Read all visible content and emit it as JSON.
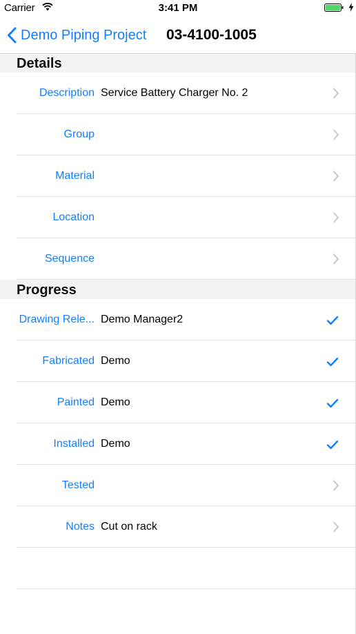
{
  "status_bar": {
    "carrier": "Carrier",
    "time": "3:41 PM"
  },
  "nav": {
    "back_label": "Demo Piping Project",
    "title": "03-4100-1005"
  },
  "sections": {
    "details": {
      "title": "Details",
      "rows": [
        {
          "label": "Description",
          "value": "Service Battery Charger No. 2",
          "accessory": "chevron-icon"
        },
        {
          "label": "Group",
          "value": "",
          "accessory": "chevron-icon"
        },
        {
          "label": "Material",
          "value": "",
          "accessory": "chevron-icon"
        },
        {
          "label": "Location",
          "value": "",
          "accessory": "chevron-icon"
        },
        {
          "label": "Sequence",
          "value": "",
          "accessory": "chevron-icon"
        }
      ]
    },
    "progress": {
      "title": "Progress",
      "rows": [
        {
          "label": "Drawing Rele...",
          "value": "Demo Manager2",
          "accessory": "checkmark-icon"
        },
        {
          "label": "Fabricated",
          "value": "Demo",
          "accessory": "checkmark-icon"
        },
        {
          "label": "Painted",
          "value": "Demo",
          "accessory": "checkmark-icon"
        },
        {
          "label": "Installed",
          "value": "Demo",
          "accessory": "checkmark-icon"
        },
        {
          "label": "Tested",
          "value": "",
          "accessory": "chevron-icon"
        },
        {
          "label": "Notes",
          "value": "Cut on rack",
          "accessory": "chevron-icon"
        }
      ]
    }
  },
  "colors": {
    "tint": "#147efb",
    "separator": "#e3e3e6",
    "section_background": "#f3f3f5"
  }
}
